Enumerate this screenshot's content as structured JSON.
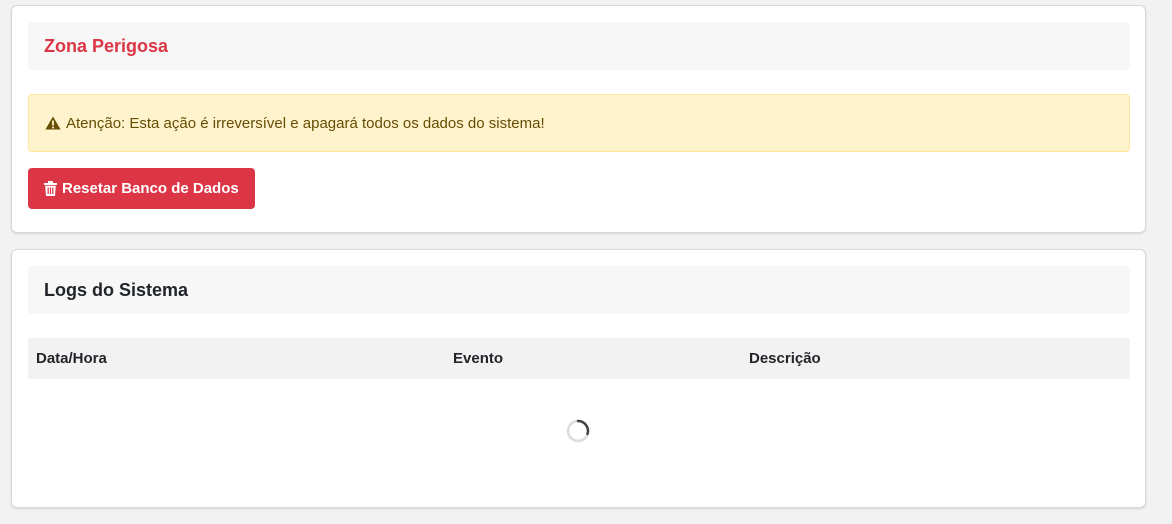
{
  "danger_zone": {
    "title": "Zona Perigosa",
    "warning_text": "Atenção: Esta ação é irreversível e apagará todos os dados do sistema!",
    "warning_icon": "warning-triangle-icon",
    "reset_button_label": "Resetar Banco de Dados",
    "reset_button_icon": "trash-icon",
    "accent_color": "#dc3545"
  },
  "logs": {
    "title": "Logs do Sistema",
    "columns": [
      "Data/Hora",
      "Evento",
      "Descrição"
    ],
    "loading_icon": "loading-spinner-icon"
  }
}
